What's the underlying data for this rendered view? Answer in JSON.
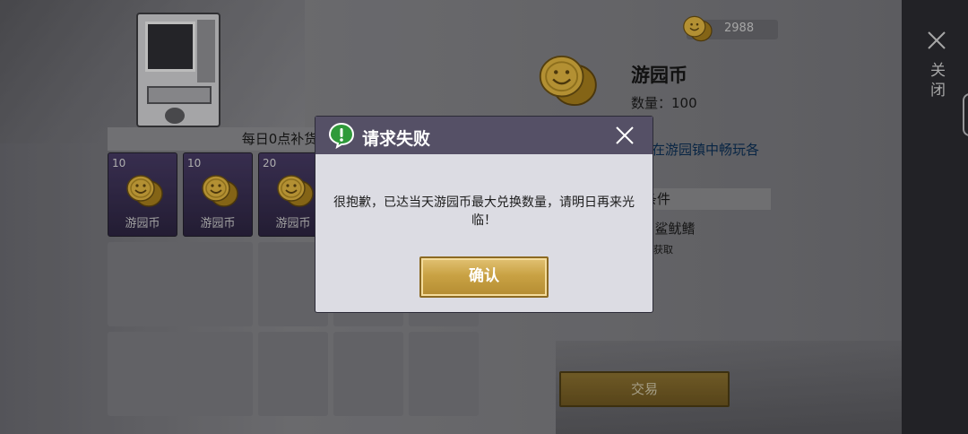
{
  "balance": {
    "amount": "2988"
  },
  "shop": {
    "restock_header": "每日0点补货（现",
    "items": [
      {
        "count": "10",
        "name": "游园币"
      },
      {
        "count": "10",
        "name": "游园币"
      },
      {
        "count": "20",
        "name": "游园币"
      }
    ]
  },
  "detail": {
    "title": "游园币",
    "quantity": "数量：100",
    "description": "以在游园镇中畅玩各",
    "conditions_header": "条件",
    "condition_item": "2）鲨鱿鳍",
    "condition_sub": "岛获取"
  },
  "actions": {
    "trade_label": "交易"
  },
  "sidebar": {
    "close_label": "关闭"
  },
  "dialog": {
    "title": "请求失败",
    "message": "很抱歉，已达当天游园币最大兑换数量，请明日再来光临！",
    "confirm_label": "确认"
  },
  "colors": {
    "dialog_header": "#555066",
    "dialog_body": "#dcdce3",
    "confirm_gold": "#c9a244",
    "alert_green": "#2f9a3a",
    "item_cell_purple": "#3a3052"
  },
  "icons": {
    "coin": "coin-icon",
    "alert": "alert-icon",
    "close": "close-icon"
  }
}
